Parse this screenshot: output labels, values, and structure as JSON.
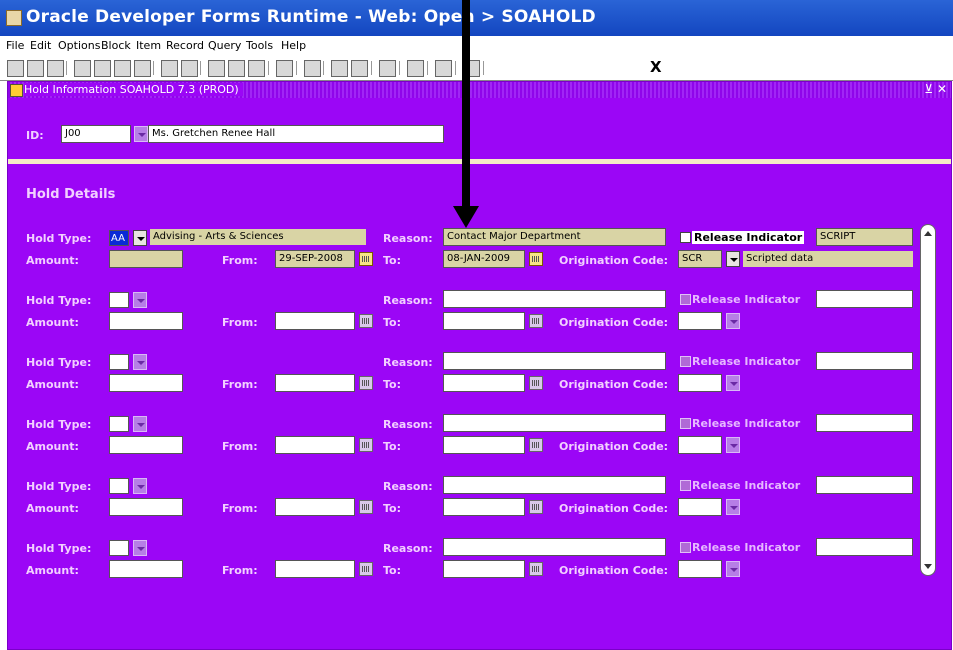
{
  "titlebar": {
    "title": "Oracle Developer Forms Runtime - Web:  Open > SOAHOLD"
  },
  "menu": [
    "File",
    "Edit",
    "Options",
    "Block",
    "Item",
    "Record",
    "Query",
    "Tools",
    "Help"
  ],
  "toolbar": {
    "exit": "X"
  },
  "window": {
    "title": "Hold Information  SOAHOLD  7.3  (PROD)",
    "controls": "⊻ ✕"
  },
  "key": {
    "id_label": "ID:",
    "id_value": "J00",
    "name": "Ms. Gretchen Renee Hall"
  },
  "section": {
    "title": "Hold Details"
  },
  "labels": {
    "hold_type": "Hold Type:",
    "amount": "Amount:",
    "from": "From:",
    "to": "To:",
    "reason": "Reason:",
    "orig": "Origination Code:",
    "release": "Release Indicator"
  },
  "records": [
    {
      "hold_type": "AA",
      "hold_desc": "Advising - Arts & Sciences",
      "amount": "",
      "from": "29-SEP-2008",
      "to": "08-JAN-2009",
      "reason": "Contact Major Department",
      "release_user": "SCRIPT",
      "orig_code": "SCR",
      "orig_desc": "Scripted data"
    },
    {
      "hold_type": "",
      "hold_desc": "",
      "amount": "",
      "from": "",
      "to": "",
      "reason": "",
      "release_user": "",
      "orig_code": "",
      "orig_desc": ""
    },
    {
      "hold_type": "",
      "hold_desc": "",
      "amount": "",
      "from": "",
      "to": "",
      "reason": "",
      "release_user": "",
      "orig_code": "",
      "orig_desc": ""
    },
    {
      "hold_type": "",
      "hold_desc": "",
      "amount": "",
      "from": "",
      "to": "",
      "reason": "",
      "release_user": "",
      "orig_code": "",
      "orig_desc": ""
    },
    {
      "hold_type": "",
      "hold_desc": "",
      "amount": "",
      "from": "",
      "to": "",
      "reason": "",
      "release_user": "",
      "orig_code": "",
      "orig_desc": ""
    },
    {
      "hold_type": "",
      "hold_desc": "",
      "amount": "",
      "from": "",
      "to": "",
      "reason": "",
      "release_user": "",
      "orig_code": "",
      "orig_desc": ""
    }
  ]
}
